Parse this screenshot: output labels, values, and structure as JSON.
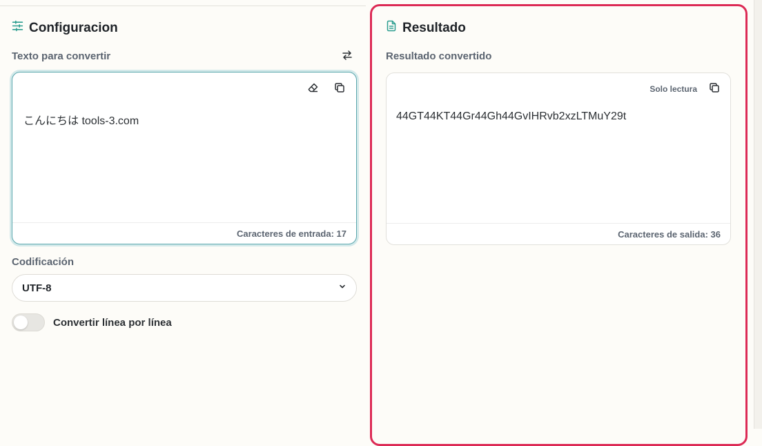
{
  "config": {
    "title": "Configuracion",
    "input_label": "Texto para convertir",
    "input_text": "こんにちは tools-3.com",
    "input_count": "Caracteres de entrada: 17",
    "encoding_label": "Codificación",
    "encoding_value": "UTF-8",
    "toggle_label": "Convertir línea por línea",
    "toggle_on": false
  },
  "result": {
    "title": "Resultado",
    "output_label": "Resultado convertido",
    "readonly_label": "Solo lectura",
    "output_text": "44GT44KT44Gr44Gh44GvIHRvb2xzLTMuY29t",
    "output_count": "Caracteres de salida: 36"
  },
  "icons": {
    "config": "sliders-icon",
    "result": "document-icon",
    "swap": "swap-arrows-icon",
    "clear": "eraser-icon",
    "copy": "copy-icon",
    "select": "chevron-down-icon"
  },
  "colors": {
    "accent": "#2a9d8f",
    "result_border": "#dc2a55",
    "input_focus_border": "#5aa7ad"
  }
}
